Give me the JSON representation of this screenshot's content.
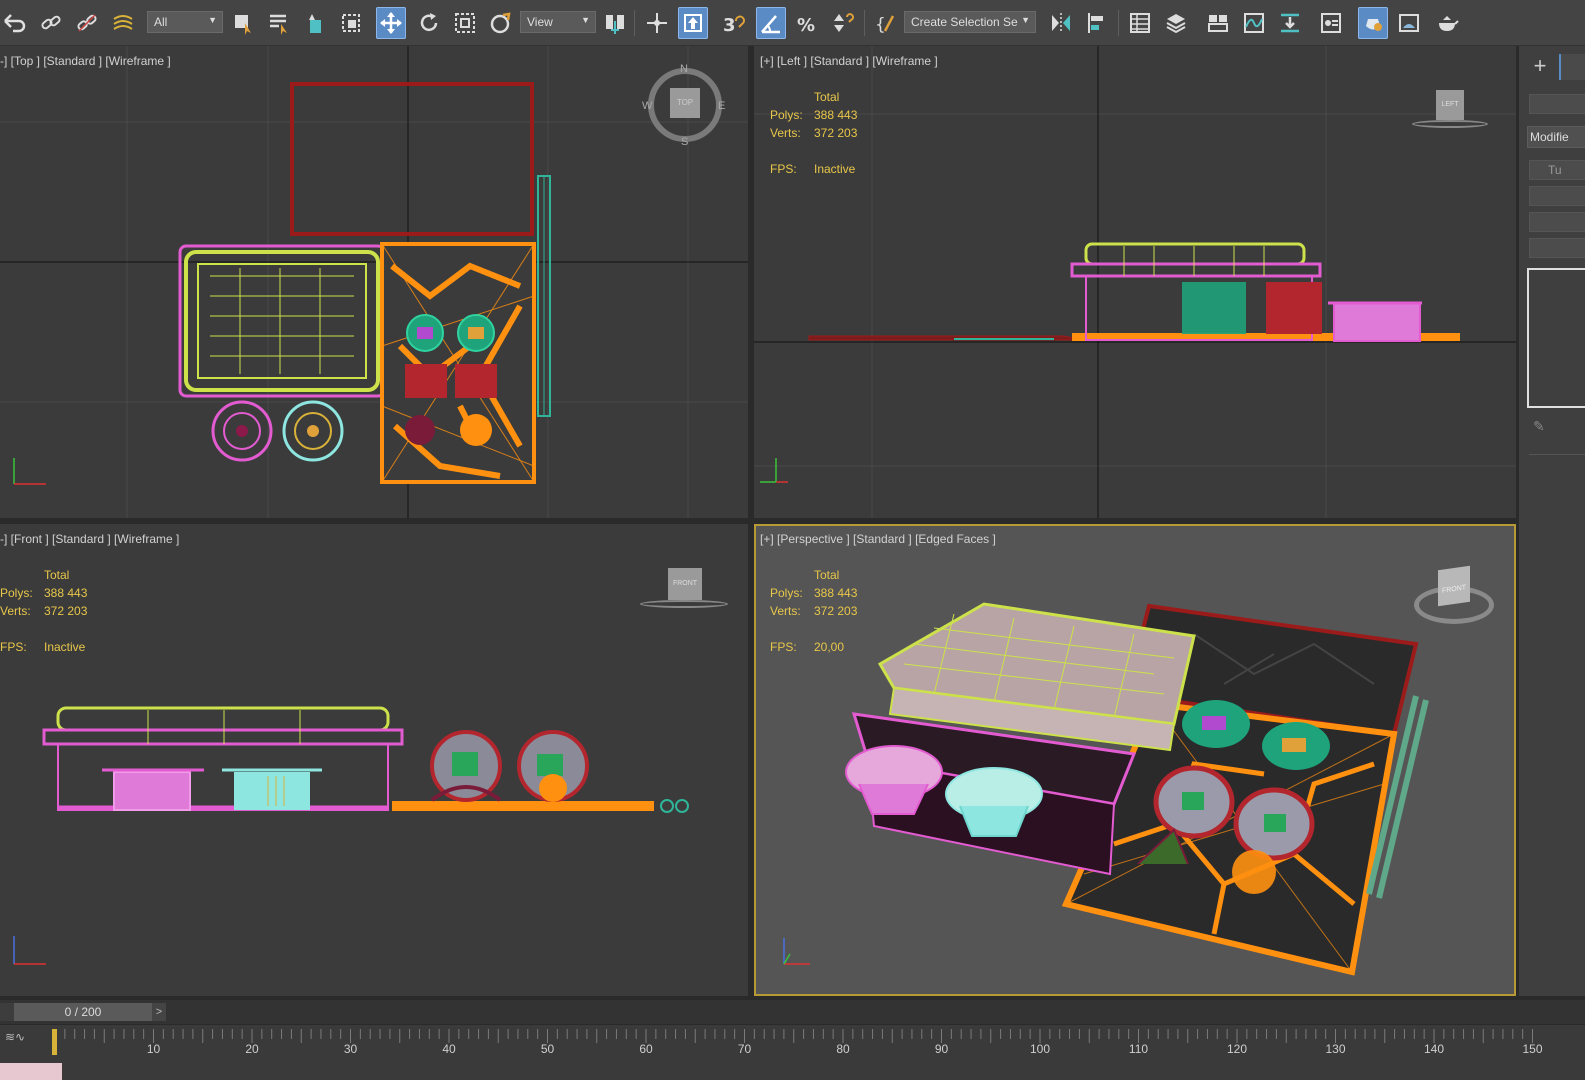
{
  "toolbar": {
    "selection_filter": "All",
    "reference_coord": "View",
    "named_selection": "Create Selection Se",
    "icons": [
      "undo-icon",
      "link-icon",
      "unlink-icon",
      "bind-spacewarp-icon",
      "select-object-icon",
      "select-by-name-icon",
      "select-region-icon",
      "window-crossing-icon",
      "select-move-icon",
      "select-rotate-icon",
      "select-scale-icon",
      "select-place-icon",
      "use-pivot-icon",
      "snap-toggle-icon",
      "angle-snap-icon",
      "percent-snap-icon",
      "spinner-snap-icon",
      "edit-named-selection-icon",
      "mirror-icon",
      "align-icon",
      "scene-explorer-icon",
      "layer-explorer-icon",
      "ribbon-icon",
      "curve-editor-icon",
      "schematic-view-icon",
      "material-editor-icon",
      "render-setup-icon",
      "rendered-frame-icon",
      "render-icon"
    ]
  },
  "viewports": {
    "top": {
      "label": "-] [Top ] [Standard ] [Wireframe ]",
      "compass": {
        "n": "N",
        "s": "S",
        "e": "E",
        "w": "W",
        "cube": "TOP"
      }
    },
    "left": {
      "label": "[+] [Left ] [Standard ] [Wireframe ]",
      "cube": "LEFT",
      "stats": {
        "total": "Total",
        "polys_label": "Polys:",
        "polys": "388 443",
        "verts_label": "Verts:",
        "verts": "372 203",
        "fps_label": "FPS:",
        "fps": "Inactive"
      }
    },
    "front": {
      "label": "-] [Front ] [Standard ] [Wireframe ]",
      "cube": "FRONT",
      "stats": {
        "total": "Total",
        "polys_label": "Polys:",
        "polys": "388 443",
        "verts_label": "Verts:",
        "verts": "372 203",
        "fps_label": "FPS:",
        "fps": "Inactive"
      }
    },
    "perspective": {
      "label": "[+] [Perspective ] [Standard ] [Edged Faces ]",
      "cube": "FRONT",
      "stats": {
        "total": "Total",
        "polys_label": "Polys:",
        "polys": "388 443",
        "verts_label": "Verts:",
        "verts": "372 203",
        "fps_label": "FPS:",
        "fps": "20,00"
      }
    }
  },
  "command_panel": {
    "create_label": "+",
    "modifier_label": "Modifie",
    "item_label": "Tu"
  },
  "timeline": {
    "frame_display": "0 / 200",
    "prev": "<",
    "next": ">",
    "ticks": [
      "10",
      "20",
      "30",
      "40",
      "50",
      "60",
      "70",
      "80",
      "90",
      "100",
      "110",
      "120",
      "130",
      "140",
      "150"
    ]
  },
  "colors": {
    "accent": "#5b8bc4",
    "stats": "#e8c74a",
    "active_viewport": "#b89a34"
  }
}
